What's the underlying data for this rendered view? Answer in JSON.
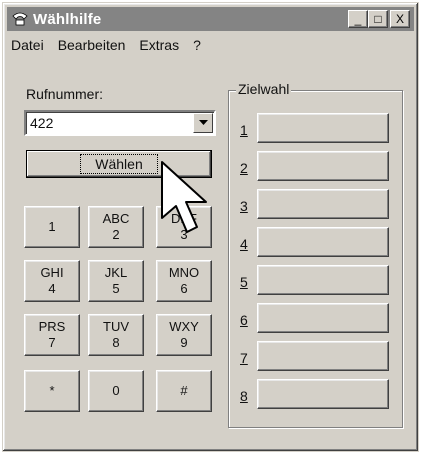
{
  "window": {
    "title": "Wählhilfe"
  },
  "titlebar_buttons": {
    "minimize": "_",
    "maximize": "□",
    "close": "X"
  },
  "menu": [
    {
      "label": "Datei"
    },
    {
      "label": "Bearbeiten"
    },
    {
      "label": "Extras"
    },
    {
      "label": "?"
    }
  ],
  "dialer": {
    "number_label": "Rufnummer:",
    "number_value": "422",
    "dial_button": "Wählen"
  },
  "keypad": [
    {
      "letters": "",
      "number": "1"
    },
    {
      "letters": "ABC",
      "number": "2"
    },
    {
      "letters": "DEF",
      "number": "3"
    },
    {
      "letters": "GHI",
      "number": "4"
    },
    {
      "letters": "JKL",
      "number": "5"
    },
    {
      "letters": "MNO",
      "number": "6"
    },
    {
      "letters": "PRS",
      "number": "7"
    },
    {
      "letters": "TUV",
      "number": "8"
    },
    {
      "letters": "WXY",
      "number": "9"
    },
    {
      "letters": "",
      "number": "*"
    },
    {
      "letters": "",
      "number": "0"
    },
    {
      "letters": "",
      "number": "#"
    }
  ],
  "speed_dial": {
    "title": "Zielwahl",
    "slots": [
      "1",
      "2",
      "3",
      "4",
      "5",
      "6",
      "7",
      "8"
    ]
  }
}
